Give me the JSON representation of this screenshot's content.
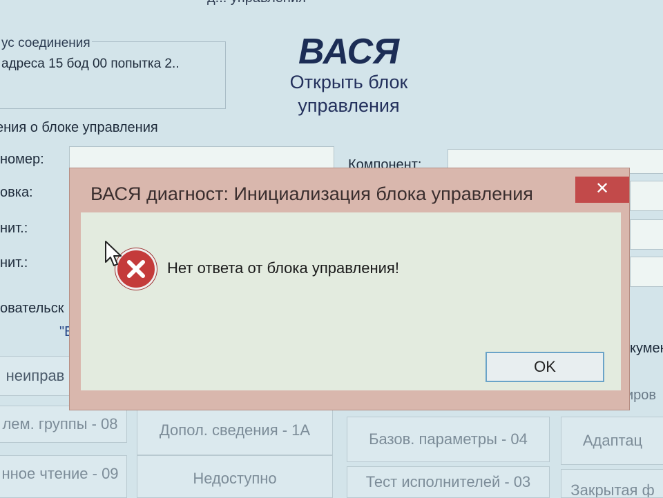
{
  "background": {
    "window_title_fragment": "д... управления",
    "status": {
      "legend": "ус соединения",
      "text": "адреса 15 бод 00 попытка 2.."
    },
    "brand": {
      "title": "ВАСЯ",
      "subtitle_line1": "Открыть блок",
      "subtitle_line2": "управления"
    },
    "info": {
      "legend": "ения о блоке управления",
      "labels": [
        "номер:",
        "овка:",
        "нит.:",
        "нит.:",
        "овательск"
      ],
      "component_label": "Компонент:",
      "quote_fragment": "\"Е",
      "right_fragment_1": "кумен",
      "right_fragment_2": "иров"
    },
    "fault_fragment": "неиправ",
    "tiles": {
      "row1": [
        "лем. группы - 08",
        "Допол. сведения - 1А",
        "Базов. параметры - 04",
        "Адаптац"
      ],
      "row2": [
        "нное чтение - 09",
        "Недоступно",
        "Тест исполнителей - 03",
        "Закрытая ф"
      ]
    }
  },
  "dialog": {
    "title": "ВАСЯ диагност: Инициализация блока управления",
    "close_glyph": "✕",
    "message": "Нет ответа от блока управления!",
    "ok_label": "OK",
    "icon": "error-x-icon"
  },
  "colors": {
    "error_red": "#c43b3b",
    "close_red": "#c24a4a",
    "brand_navy": "#1c2d55",
    "ok_border": "#6aa3c8"
  }
}
